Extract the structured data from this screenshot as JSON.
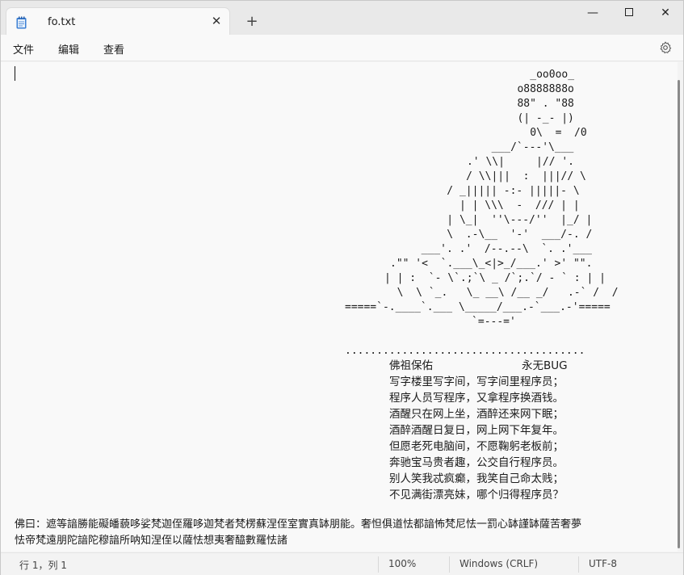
{
  "window": {
    "tab_title": "fo.txt",
    "tab_close": "✕",
    "new_tab": "+",
    "minimize": "—",
    "close": "✕"
  },
  "menu": {
    "file": "文件",
    "edit": "编辑",
    "view": "查看"
  },
  "icons": {
    "notepad": "notepad-icon",
    "settings": "gear-icon"
  },
  "content": {
    "art": [
      "          _oo0oo_",
      "         o8888888o",
      "         88\" . \"88",
      "         (| -_- |)",
      "          0\\  =  /0",
      "        ___/`---'\\___",
      "      .' \\\\|     |// '.",
      "     / \\\\|||  :  |||// \\",
      "    / _||||| -:- |||||- \\",
      "      | | \\\\\\  -  /// | |",
      "    | \\_|  ''\\---/''  |_/ |",
      "    \\  .-\\__  '-'  ___/-. /",
      "  ___'. .'  /--.--\\  `. .'___",
      ".\"\" '<  `.___\\_<|>_/___.' >' \"\".",
      "| | :  `- \\`.;`\\ _ /`;.`/ - ` : | |",
      "  \\  \\ `_.   \\_ __\\ /__ _/   .-` /  /",
      "=====`-.____`.___ \\_____/___.-`___.-'=====",
      "                 `=---='"
    ],
    "dots": "......................................",
    "poem_header_left": "佛祖保佑",
    "poem_header_right": "永无BUG",
    "poem": [
      "写字楼里写字间，写字间里程序员；",
      "程序人员写程序，又拿程序换酒钱。",
      "酒醒只在网上坐，酒醉还来网下眠；",
      "酒醉酒醒日复日，网上网下年复年。",
      "但愿老死电脑间，不愿鞠躬老板前；",
      "奔驰宝马贵者趣，公交自行程序员。",
      "别人笑我忒疯癫，我笑自己命太贱；",
      "不见满街漂亮妹，哪个归得程序员？"
    ],
    "mantra_line1": "佛曰：遮等諳勝能礙皤藐哆娑梵迦侄羅哆迦梵者梵楞蘇涅侄室實真缽朋能。奢怛俱道怯都諳怖梵尼怯一罰心缽謹缽薩苦奢夢",
    "mantra_line2": "怯帝梵遠朋陀諳陀穆諳所呐知涅侄以薩怯想夷奢醯數羅怯諸"
  },
  "status": {
    "position": "行 1，列 1",
    "zoom": "100%",
    "line_ending": "Windows (CRLF)",
    "encoding": "UTF-8"
  }
}
